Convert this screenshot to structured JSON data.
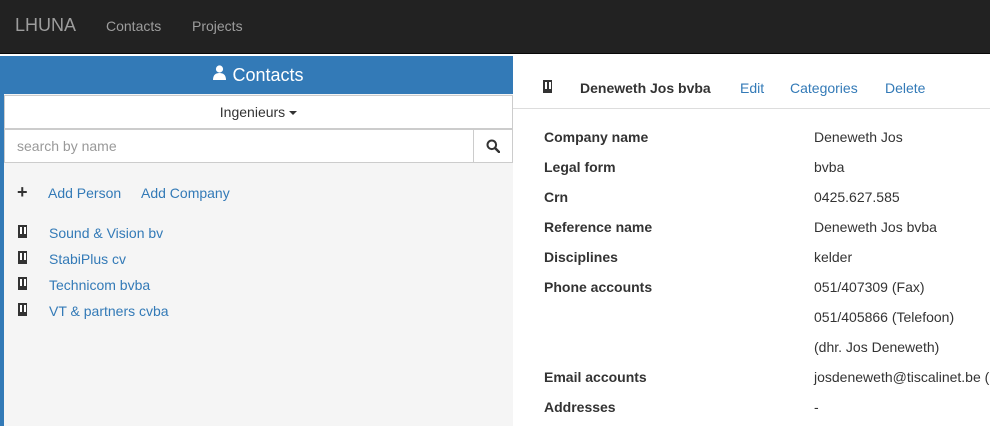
{
  "navbar": {
    "brand": "LHUNA",
    "links": [
      "Contacts",
      "Projects"
    ]
  },
  "left_panel": {
    "title": "Contacts",
    "filter_label": "Ingenieurs",
    "search_placeholder": "search by name",
    "add_person": "Add Person",
    "add_company": "Add Company",
    "companies": [
      "Sound & Vision bv",
      "StabiPlus cv",
      "Technicom bvba",
      "VT & partners cvba"
    ]
  },
  "detail": {
    "title": "Deneweth Jos bvba",
    "actions": [
      "Edit",
      "Categories",
      "Delete"
    ],
    "fields": [
      {
        "label": "Company name",
        "values": [
          "Deneweth Jos"
        ]
      },
      {
        "label": "Legal form",
        "values": [
          "bvba"
        ]
      },
      {
        "label": "Crn",
        "values": [
          "0425.627.585"
        ]
      },
      {
        "label": "Reference name",
        "values": [
          "Deneweth Jos bvba"
        ]
      },
      {
        "label": "Disciplines",
        "values": [
          "kelder"
        ]
      },
      {
        "label": "Phone accounts",
        "values": [
          "051/407309 (Fax)",
          "051/405866 (Telefoon)",
          "(dhr. Jos Deneweth)"
        ]
      },
      {
        "label": "Email accounts",
        "values": [
          "josdeneweth@tiscalinet.be ("
        ]
      },
      {
        "label": "Addresses",
        "values": [
          "-"
        ]
      }
    ]
  },
  "colors": {
    "navbar_bg": "#222222",
    "accent": "#337ab7",
    "panel_bg": "#f5f5f5"
  }
}
